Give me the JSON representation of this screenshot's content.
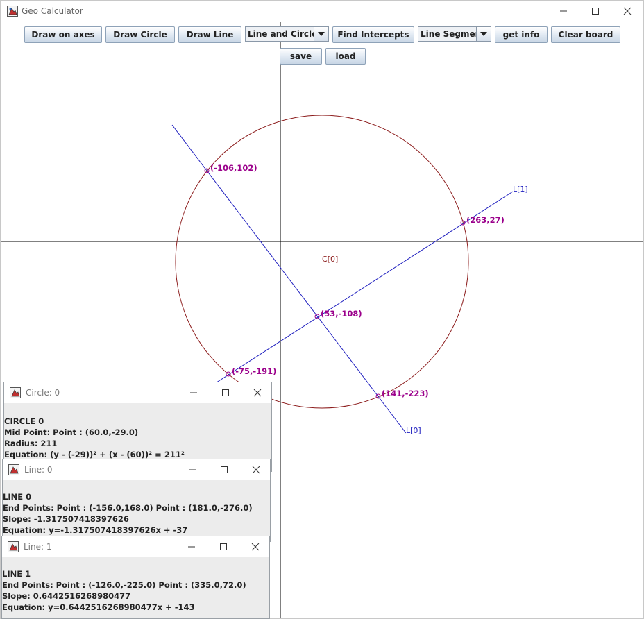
{
  "window": {
    "title": "Geo Calculator"
  },
  "toolbar": {
    "draw_on_axes": "Draw on axes",
    "draw_circle": "Draw Circle",
    "draw_line": "Draw Line",
    "intercept_mode": "Line and Circle",
    "find_intercepts": "Find Intercepts",
    "line_type": "Line Segment",
    "get_info": "get info",
    "clear_board": "Clear board",
    "save": "save",
    "load": "load"
  },
  "board": {
    "colors": {
      "axes": "#000000",
      "circle": "#8b1a1a",
      "line": "#1f1fbf",
      "point": "#9b008b"
    },
    "circle_label": "C[0]",
    "line_labels": [
      "L[0]",
      "L[1]"
    ],
    "points": [
      {
        "label": "(-106,102)"
      },
      {
        "label": "(263,27)"
      },
      {
        "label": "(53,-108)"
      },
      {
        "label": "(-75,-191)"
      },
      {
        "label": "(141,-223)"
      }
    ]
  },
  "info_windows": [
    {
      "title": "Circle: 0",
      "lines": [
        "CIRCLE 0",
        "Mid Point: Point : (60.0,-29.0)",
        "Radius: 211",
        "Equation: (y - (-29))² + (x - (60))² = 211²"
      ]
    },
    {
      "title": "Line: 0",
      "lines": [
        "LINE 0",
        "End Points: Point : (-156.0,168.0) Point : (181.0,-276.0)",
        "Slope: -1.317507418397626",
        "Equation: y=-1.317507418397626x + -37"
      ]
    },
    {
      "title": "Line: 1",
      "lines": [
        "LINE 1",
        "End Points: Point : (-126.0,-225.0) Point : (335.0,72.0)",
        "Slope: 0.6442516268980477",
        "Equation: y=0.6442516268980477x + -143"
      ]
    }
  ]
}
